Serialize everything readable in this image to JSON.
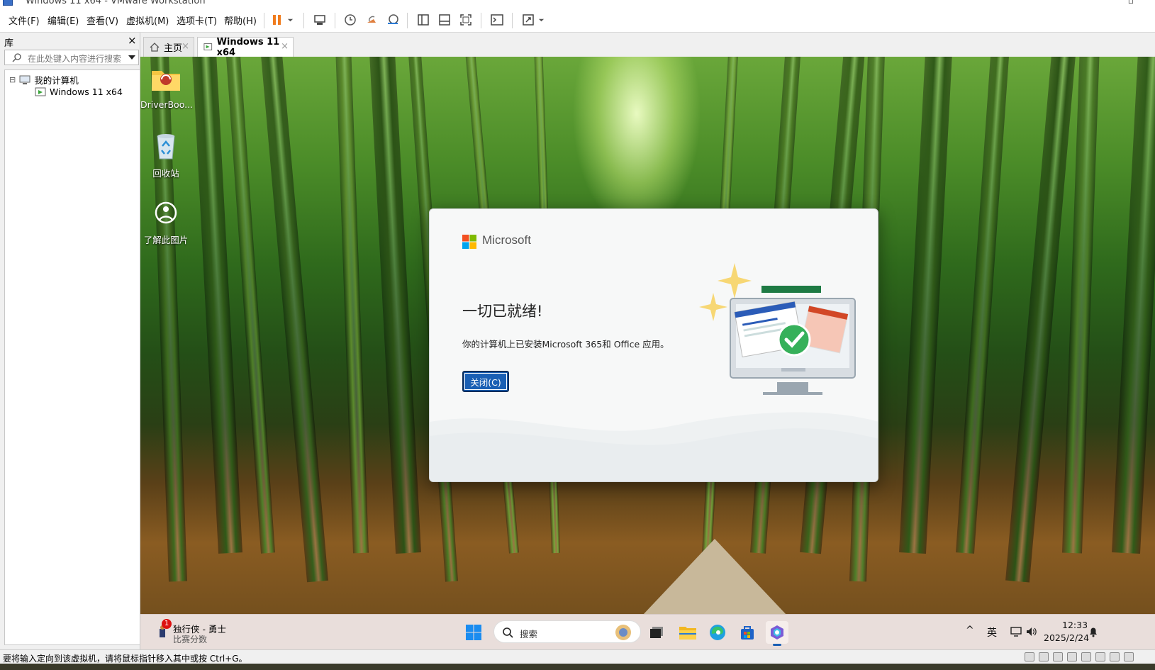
{
  "window": {
    "title": "Windows 11 x64 - VMware Workstation"
  },
  "menu": {
    "items": [
      "文件(F)",
      "编辑(E)",
      "查看(V)",
      "虚拟机(M)",
      "选项卡(T)",
      "帮助(H)"
    ]
  },
  "toolbar": {
    "icons": [
      "pause-icon",
      "dropdown-icon",
      "send-ctrl-alt-del-icon",
      "snapshot-icon",
      "revert-snapshot-icon",
      "snapshot-manager-icon",
      "library-view-icon",
      "thumbnail-view-icon",
      "fullscreen-icon",
      "console-icon",
      "stretch-icon",
      "dropdown-icon"
    ]
  },
  "library": {
    "title": "库",
    "close": "×",
    "search_placeholder": "在此处键入内容进行搜索",
    "tree": {
      "root_toggle": "⊟",
      "root_label": "我的计算机",
      "child_label": "Windows 11 x64"
    }
  },
  "tabs": [
    {
      "label": "主页",
      "close": "×"
    },
    {
      "label": "Windows 11 x64",
      "close": "×"
    }
  ],
  "desktop": {
    "icons": [
      {
        "label": "DriverBoo..."
      },
      {
        "label": "回收站"
      },
      {
        "label": "了解此图片"
      }
    ]
  },
  "dialog": {
    "brand": "Microsoft",
    "heading": "一切已就绪!",
    "body": "你的计算机上已安装Microsoft 365和 Office 应用。",
    "close_button": "关闭(C)"
  },
  "taskbar": {
    "widget_badge": "1",
    "widget_title": "独行侠 - 勇士",
    "widget_subtitle": "比赛分数",
    "search_label": "搜索",
    "ime": "英",
    "time": "12:33",
    "date": "2025/2/24",
    "chevron": "^"
  },
  "statusbar": {
    "message": "要将输入定向到该虚拟机，请将鼠标指针移入其中或按 Ctrl+G。"
  },
  "colors": {
    "accent": "#1a5fb4",
    "pause": "#f07c1e",
    "ms_red": "#f25022",
    "ms_green": "#7fba00",
    "ms_blue": "#00a4ef",
    "ms_yellow": "#ffb900"
  }
}
